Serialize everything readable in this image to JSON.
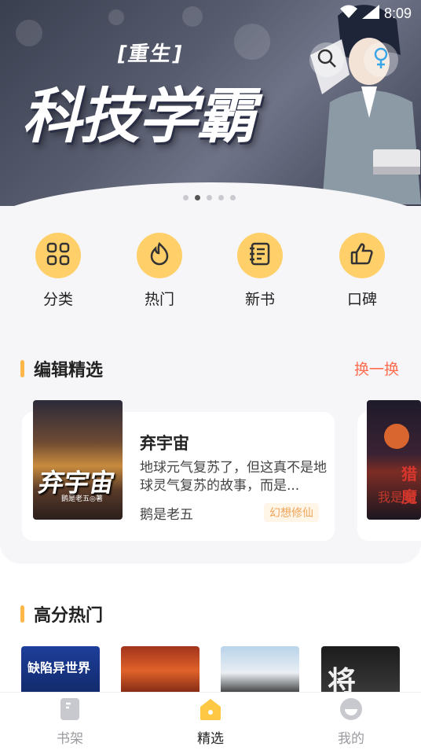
{
  "status_bar": {
    "time": "8:09"
  },
  "banner": {
    "tag": "[重生]",
    "title": "科技学霸",
    "dots": 5,
    "active_dot": 1
  },
  "quick_links": [
    {
      "label": "分类",
      "icon": "grid-icon"
    },
    {
      "label": "热门",
      "icon": "flame-icon"
    },
    {
      "label": "新书",
      "icon": "notebook-icon"
    },
    {
      "label": "口碑",
      "icon": "thumbs-up-icon"
    }
  ],
  "editor_picks": {
    "title": "编辑精选",
    "action": "换一换",
    "book": {
      "title": "弃宇宙",
      "description": "地球元气复苏了，但这真不是地球灵气复苏的故事，而是...",
      "author": "鹅是老五",
      "tag": "幻想修仙",
      "cover_title": "弃宇宙",
      "cover_author": "鹅是老五◎著"
    },
    "next_cover_title": "猎魔",
    "next_cover_sub": "我是老"
  },
  "high_score": {
    "title": "高分热门",
    "covers": [
      "缺陷异世界",
      "",
      "",
      "将"
    ]
  },
  "tabbar": {
    "tabs": [
      {
        "label": "书架",
        "icon": "bookshelf-icon",
        "active": false
      },
      {
        "label": "精选",
        "icon": "home-icon",
        "active": true
      },
      {
        "label": "我的",
        "icon": "profile-icon",
        "active": false
      }
    ]
  },
  "colors": {
    "accent": "#ffcf6a",
    "section_bar": "#ffb74a",
    "swap_text": "#ff6b4e",
    "tag_text": "#f0a45a"
  }
}
